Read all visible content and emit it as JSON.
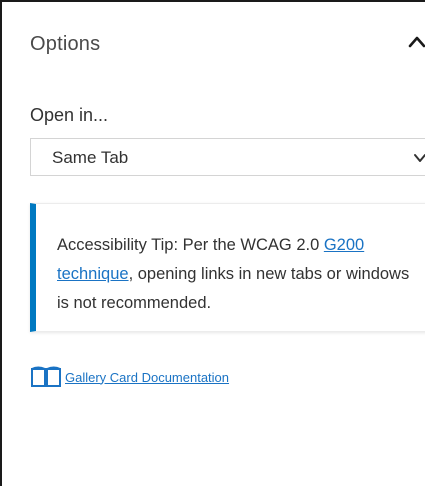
{
  "panel": {
    "title": "Options",
    "collapse_icon": "chevron-up-icon"
  },
  "open_in": {
    "label": "Open in...",
    "selected": "Same Tab",
    "dropdown_icon": "chevron-down-icon"
  },
  "tip": {
    "prefix": "Accessibility Tip: Per the WCAG 2.0 ",
    "link1": "G200",
    "link2": "technique",
    "suffix": ", opening links in new tabs or windows is not recommended.",
    "accent_color": "#0079c1"
  },
  "documentation": {
    "icon": "book-icon",
    "link_text": "Gallery Card Documentation"
  },
  "colors": {
    "link": "#1a73c4",
    "text": "#323232"
  }
}
